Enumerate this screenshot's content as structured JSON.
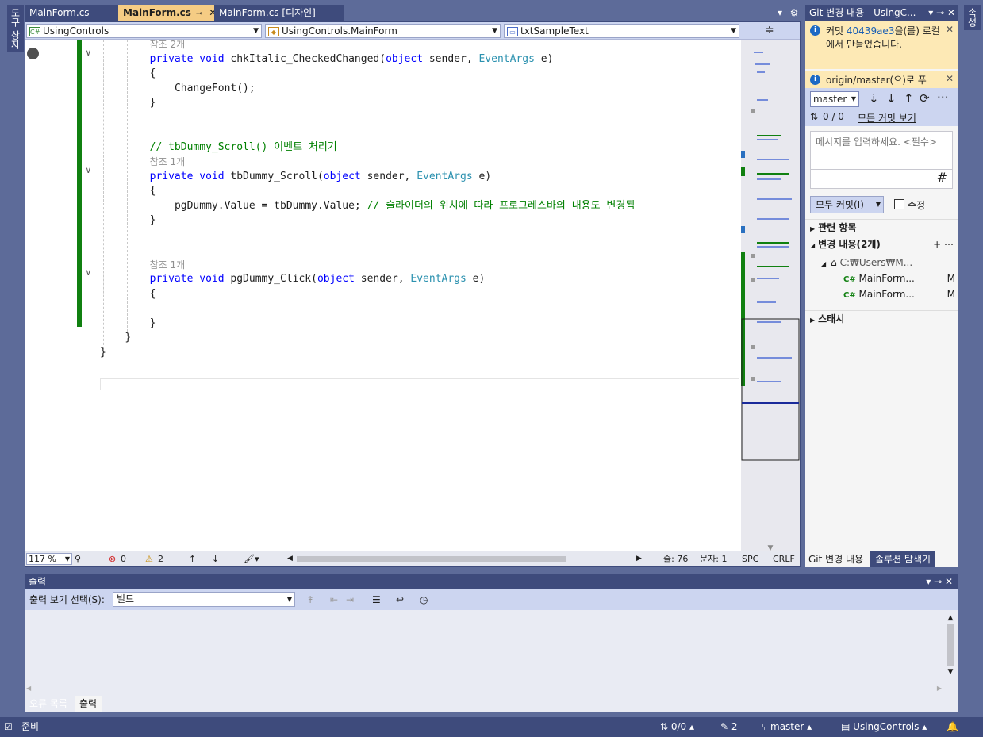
{
  "left_tool_tab": "도구 상자",
  "right_tool_tab": "속성",
  "doc_tabs": [
    {
      "label": "MainForm.cs"
    },
    {
      "label": "MainForm.cs",
      "pin": "⊸",
      "close": "✕"
    },
    {
      "label": "MainForm.cs [디자인]"
    }
  ],
  "tabs_menu_glyph": "▾",
  "tabs_gear_glyph": "⚙",
  "nav": {
    "project": "UsingControls",
    "class": "UsingControls.MainForm",
    "member": "txtSampleText",
    "project_icon": "C#",
    "split_glyph": "≑"
  },
  "code_lines": [
    {
      "indent": 8,
      "ref": "참조 2개"
    },
    {
      "indent": 8,
      "text": "private void chkItalic_CheckedChanged(object sender, EventArgs e)"
    },
    {
      "indent": 8,
      "text": "{"
    },
    {
      "indent": 12,
      "text": "ChangeFont();"
    },
    {
      "indent": 8,
      "text": "}"
    },
    {
      "indent": 8,
      "text": ""
    },
    {
      "indent": 8,
      "text": ""
    },
    {
      "indent": 8,
      "comment": "// tbDummy_Scroll() 이벤트 처리기"
    },
    {
      "indent": 8,
      "ref": "참조 1개"
    },
    {
      "indent": 8,
      "text": "private void tbDummy_Scroll(object sender, EventArgs e)"
    },
    {
      "indent": 8,
      "text": "{"
    },
    {
      "indent": 12,
      "text": "pgDummy.Value = tbDummy.Value;",
      "comment": " // 슬라이더의 위치에 따라 프로그레스바의 내용도 변경됨"
    },
    {
      "indent": 8,
      "text": "}"
    },
    {
      "indent": 8,
      "text": ""
    },
    {
      "indent": 8,
      "text": ""
    },
    {
      "indent": 8,
      "ref": "참조 1개"
    },
    {
      "indent": 8,
      "text": "private void pgDummy_Click(object sender, EventArgs e)"
    },
    {
      "indent": 8,
      "text": "{"
    },
    {
      "indent": 8,
      "text": ""
    },
    {
      "indent": 8,
      "text": "}"
    },
    {
      "indent": 4,
      "text": "}"
    },
    {
      "indent": 0,
      "text": "}"
    }
  ],
  "editor_status": {
    "zoom": "117 %",
    "errors": "0",
    "warnings": "2",
    "line": "줄: 76",
    "col": "문자: 1",
    "spc": "SPC",
    "crlf": "CRLF"
  },
  "git": {
    "title": "Git 변경 내용 - UsingC...",
    "notice1_prefix": "커밋 ",
    "notice1_hash": "40439ae3",
    "notice1_suffix": "을(를) 로컬에서 만들었습니다.",
    "notice2": "origin/master(으)로 푸",
    "branch": "master",
    "sync": "0 / 0",
    "all_commits": "모든 커밋 보기",
    "message_placeholder": "메시지를 입력하세요. <필수>",
    "commit_all": "모두 커밋(I)",
    "amend": "수정",
    "related": "관련 항목",
    "changes": "변경 내용(2개)",
    "repo_path": "C:₩Users₩M...",
    "files": [
      {
        "icon": "C#",
        "name": "MainForm...",
        "status": "M"
      },
      {
        "icon": "C#",
        "name": "MainForm...",
        "status": "M"
      }
    ],
    "stash": "스태시",
    "bottom_tabs": [
      "Git 변경 내용",
      "솔루션 탐색기"
    ]
  },
  "output": {
    "title": "출력",
    "show_output_label": "출력 보기 선택(S):",
    "source": "빌드",
    "bottom_tabs": [
      "오류 목록",
      "출력"
    ]
  },
  "status": {
    "ready": "준비",
    "sync": "0/0",
    "edits": "2",
    "branch": "master",
    "repo": "UsingControls"
  }
}
